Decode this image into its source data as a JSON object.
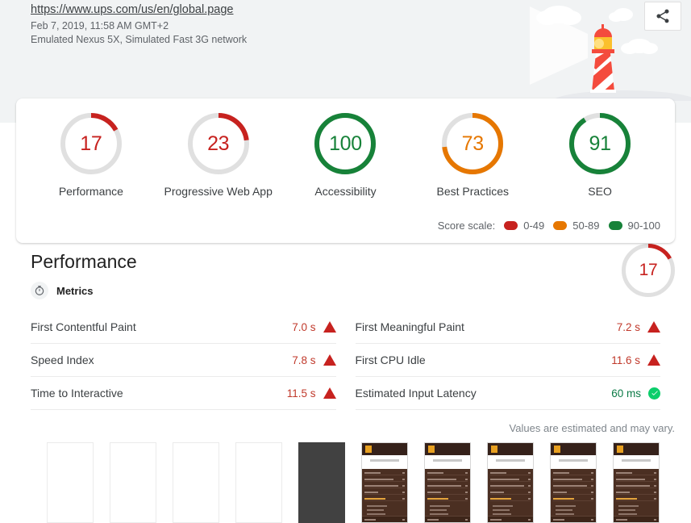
{
  "header": {
    "url": "https://www.ups.com/us/en/global.page",
    "timestamp": "Feb 7, 2019, 11:58 AM GMT+2",
    "environment": "Emulated Nexus 5X, Simulated Fast 3G network",
    "share_icon": "share-icon",
    "hero_icon": "lighthouse-illustration"
  },
  "colors": {
    "fail": "#c7221f",
    "average": "#e67700",
    "pass": "#178239",
    "pass_check": "#0cce6b",
    "track": "#e0e0e0",
    "header_bg": "#f1f3f4"
  },
  "scores": [
    {
      "label": "Performance",
      "value": 17,
      "color": "#c7221f",
      "level": "fail"
    },
    {
      "label": "Progressive Web App",
      "value": 23,
      "color": "#c7221f",
      "level": "fail"
    },
    {
      "label": "Accessibility",
      "value": 100,
      "color": "#178239",
      "level": "pass"
    },
    {
      "label": "Best Practices",
      "value": 73,
      "color": "#e67700",
      "level": "average"
    },
    {
      "label": "SEO",
      "value": 91,
      "color": "#178239",
      "level": "pass"
    }
  ],
  "score_scale": {
    "label": "Score scale:",
    "ranges": [
      {
        "text": "0-49",
        "color": "#c7221f"
      },
      {
        "text": "50-89",
        "color": "#e67700"
      },
      {
        "text": "90-100",
        "color": "#178239"
      }
    ]
  },
  "performance": {
    "title": "Performance",
    "score": 17,
    "score_color": "#c7221f",
    "metrics_heading": "Metrics",
    "metrics_icon": "stopwatch-icon",
    "left_metrics": [
      {
        "name": "First Contentful Paint",
        "value": "7.0 s",
        "status": "fail",
        "icon": "warning-triangle-icon"
      },
      {
        "name": "Speed Index",
        "value": "7.8 s",
        "status": "fail",
        "icon": "warning-triangle-icon"
      },
      {
        "name": "Time to Interactive",
        "value": "11.5 s",
        "status": "fail",
        "icon": "warning-triangle-icon"
      }
    ],
    "right_metrics": [
      {
        "name": "First Meaningful Paint",
        "value": "7.2 s",
        "status": "fail",
        "icon": "warning-triangle-icon"
      },
      {
        "name": "First CPU Idle",
        "value": "11.6 s",
        "status": "fail",
        "icon": "warning-triangle-icon"
      },
      {
        "name": "Estimated Input Latency",
        "value": "60 ms",
        "status": "pass",
        "icon": "check-circle-icon"
      }
    ],
    "estimate_note": "Values are estimated and may vary.",
    "filmstrip": [
      {
        "kind": "blank"
      },
      {
        "kind": "blank"
      },
      {
        "kind": "blank"
      },
      {
        "kind": "blank"
      },
      {
        "kind": "dark"
      },
      {
        "kind": "page"
      },
      {
        "kind": "page"
      },
      {
        "kind": "page"
      },
      {
        "kind": "page"
      },
      {
        "kind": "page"
      }
    ]
  }
}
